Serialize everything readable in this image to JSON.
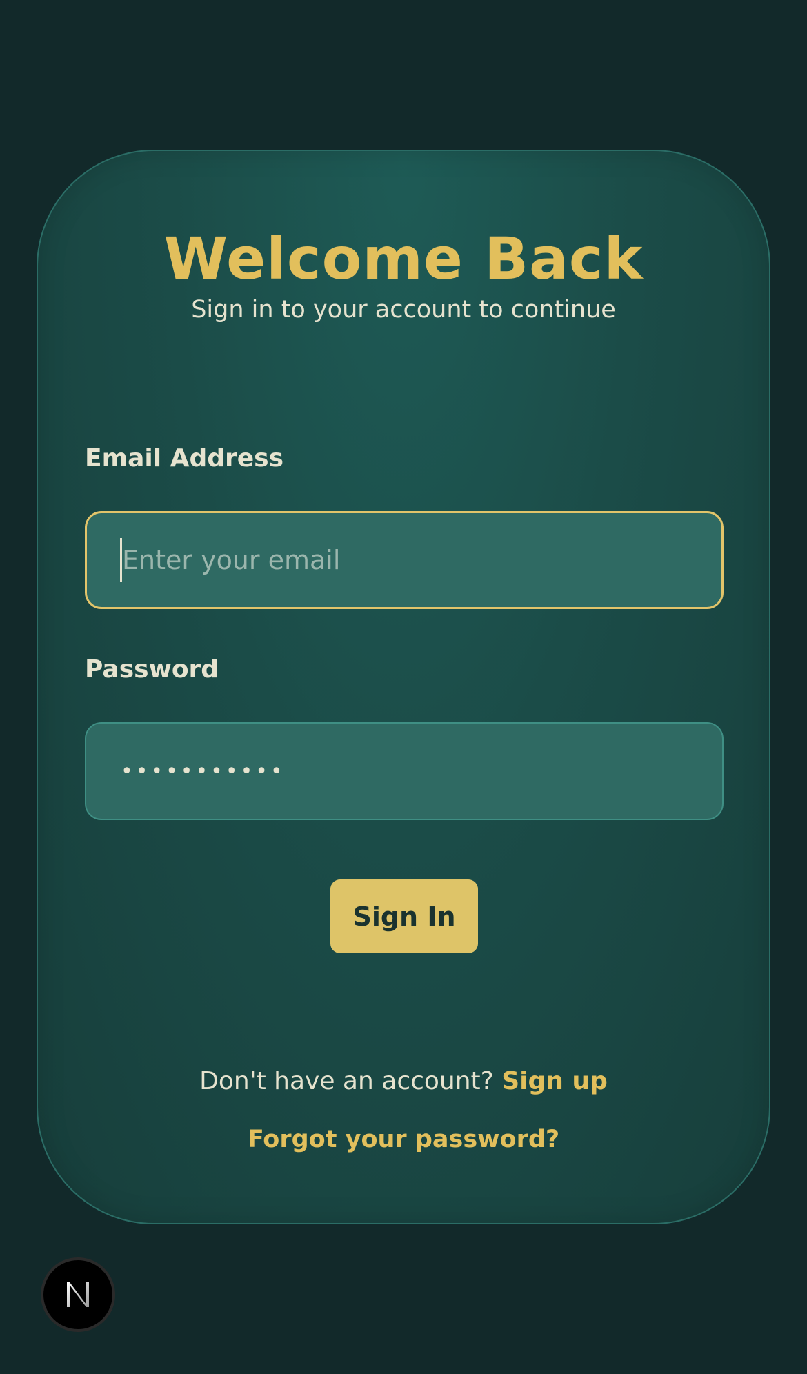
{
  "login": {
    "title": "Welcome Back",
    "subtitle": "Sign in to your account to continue",
    "email_label": "Email Address",
    "email_placeholder": "Enter your email",
    "password_label": "Password",
    "password_value": "•••••••••••",
    "submit_label": "Sign In",
    "signup_prompt": "Don't have an account?",
    "signup_link": "Sign up",
    "forgot_link": "Forgot your password?"
  },
  "badge": {
    "icon": "nextjs-logo-icon"
  },
  "colors": {
    "background": "#12292a",
    "card": "#1b4c48",
    "accent": "#e2bf5c",
    "button": "#dec468",
    "field": "#2f6a63",
    "text": "#e6e3cf"
  }
}
